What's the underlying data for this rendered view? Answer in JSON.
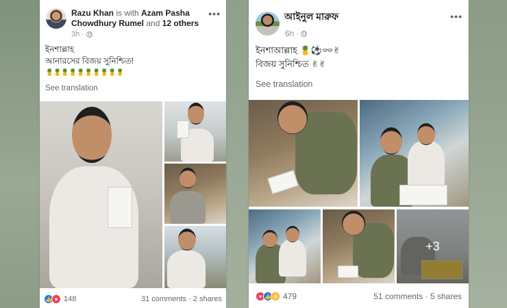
{
  "posts": {
    "left": {
      "author": "Razu Khan",
      "with_word": "is with",
      "tagged": "Azam Pasha Chowdhury Rumel",
      "and_word": "and",
      "others": "12 others",
      "time": "3h",
      "line1": "ইনশাল্লাহ",
      "line2": "আনারসের বিজয় সুনিশ্চিত!",
      "emoji_line": "🍍🍍🍍🍍🍍🍍🍍🍍🍍🍍",
      "see_translation": "See translation",
      "reaction_count": "148",
      "comments": "31 comments",
      "shares": "2 shares",
      "separator": "·"
    },
    "right": {
      "author": "আইনুল মারুফ",
      "time": "6h",
      "line1": "ইনশাআল্লাহ 🍍⚽👓✌",
      "line2": "বিজয় সুনিশ্চিত ✌✌",
      "see_translation": "See translation",
      "more_photos": "+3",
      "reaction_count": "479",
      "comments": "51 comments",
      "shares": "5 shares",
      "separator": "·"
    }
  },
  "icons": {
    "menu": "more-dots-icon",
    "privacy": "globe-icon",
    "reactions": [
      "like-icon",
      "love-icon",
      "haha-icon"
    ]
  },
  "colors": {
    "like": "#1877f2",
    "love": "#f33e58",
    "haha": "#f7b125",
    "text": "#1c1e21",
    "secondary": "#606770"
  }
}
